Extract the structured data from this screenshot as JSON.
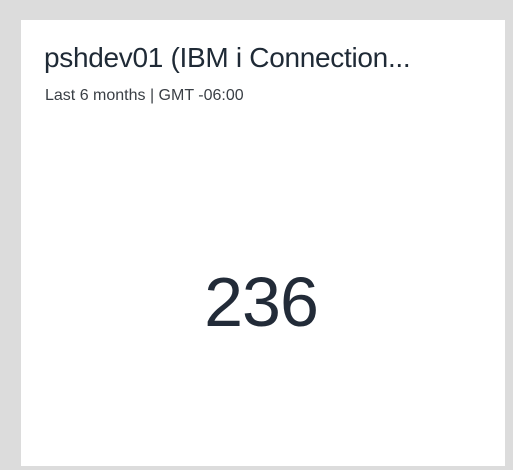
{
  "widget": {
    "title": "pshdev01 (IBM i Connection...",
    "subtitle": "Last 6 months | GMT -06:00",
    "value": "236"
  },
  "colors": {
    "background": "#dcdcdc",
    "card": "#ffffff",
    "text": "#1f2a36"
  }
}
